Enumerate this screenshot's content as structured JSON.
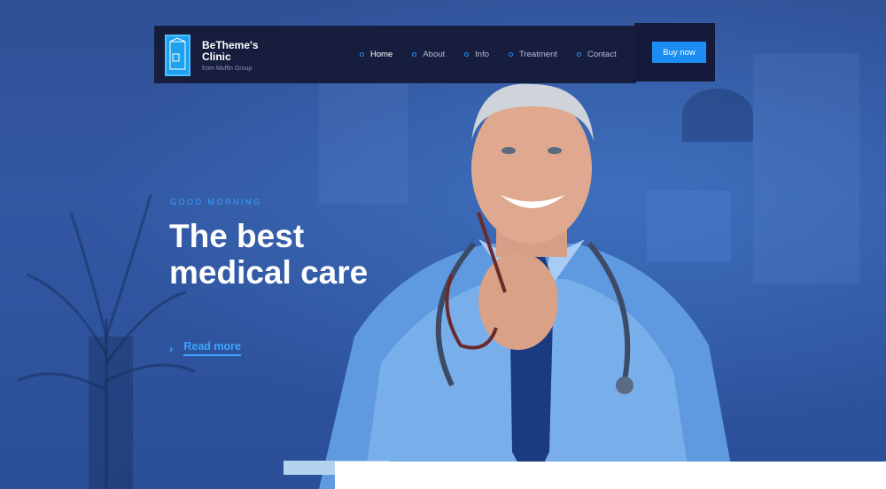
{
  "brand": {
    "name": "BeTheme's Clinic",
    "tagline": "from Muffin Group",
    "logo_icon": "building-icon"
  },
  "nav": {
    "items": [
      {
        "label": "Home",
        "active": true
      },
      {
        "label": "About",
        "active": false
      },
      {
        "label": "Info",
        "active": false
      },
      {
        "label": "Treatment",
        "active": false
      },
      {
        "label": "Contact",
        "active": false
      }
    ],
    "buy_label": "Buy now"
  },
  "hero": {
    "eyebrow": "GOOD MORNING",
    "headline_line1": "The best",
    "headline_line2": "medical care",
    "read_more": "Read more"
  },
  "colors": {
    "accent": "#1c8df2",
    "nav_bg": "#171d3d",
    "hero_bg": "#2f4f95"
  }
}
